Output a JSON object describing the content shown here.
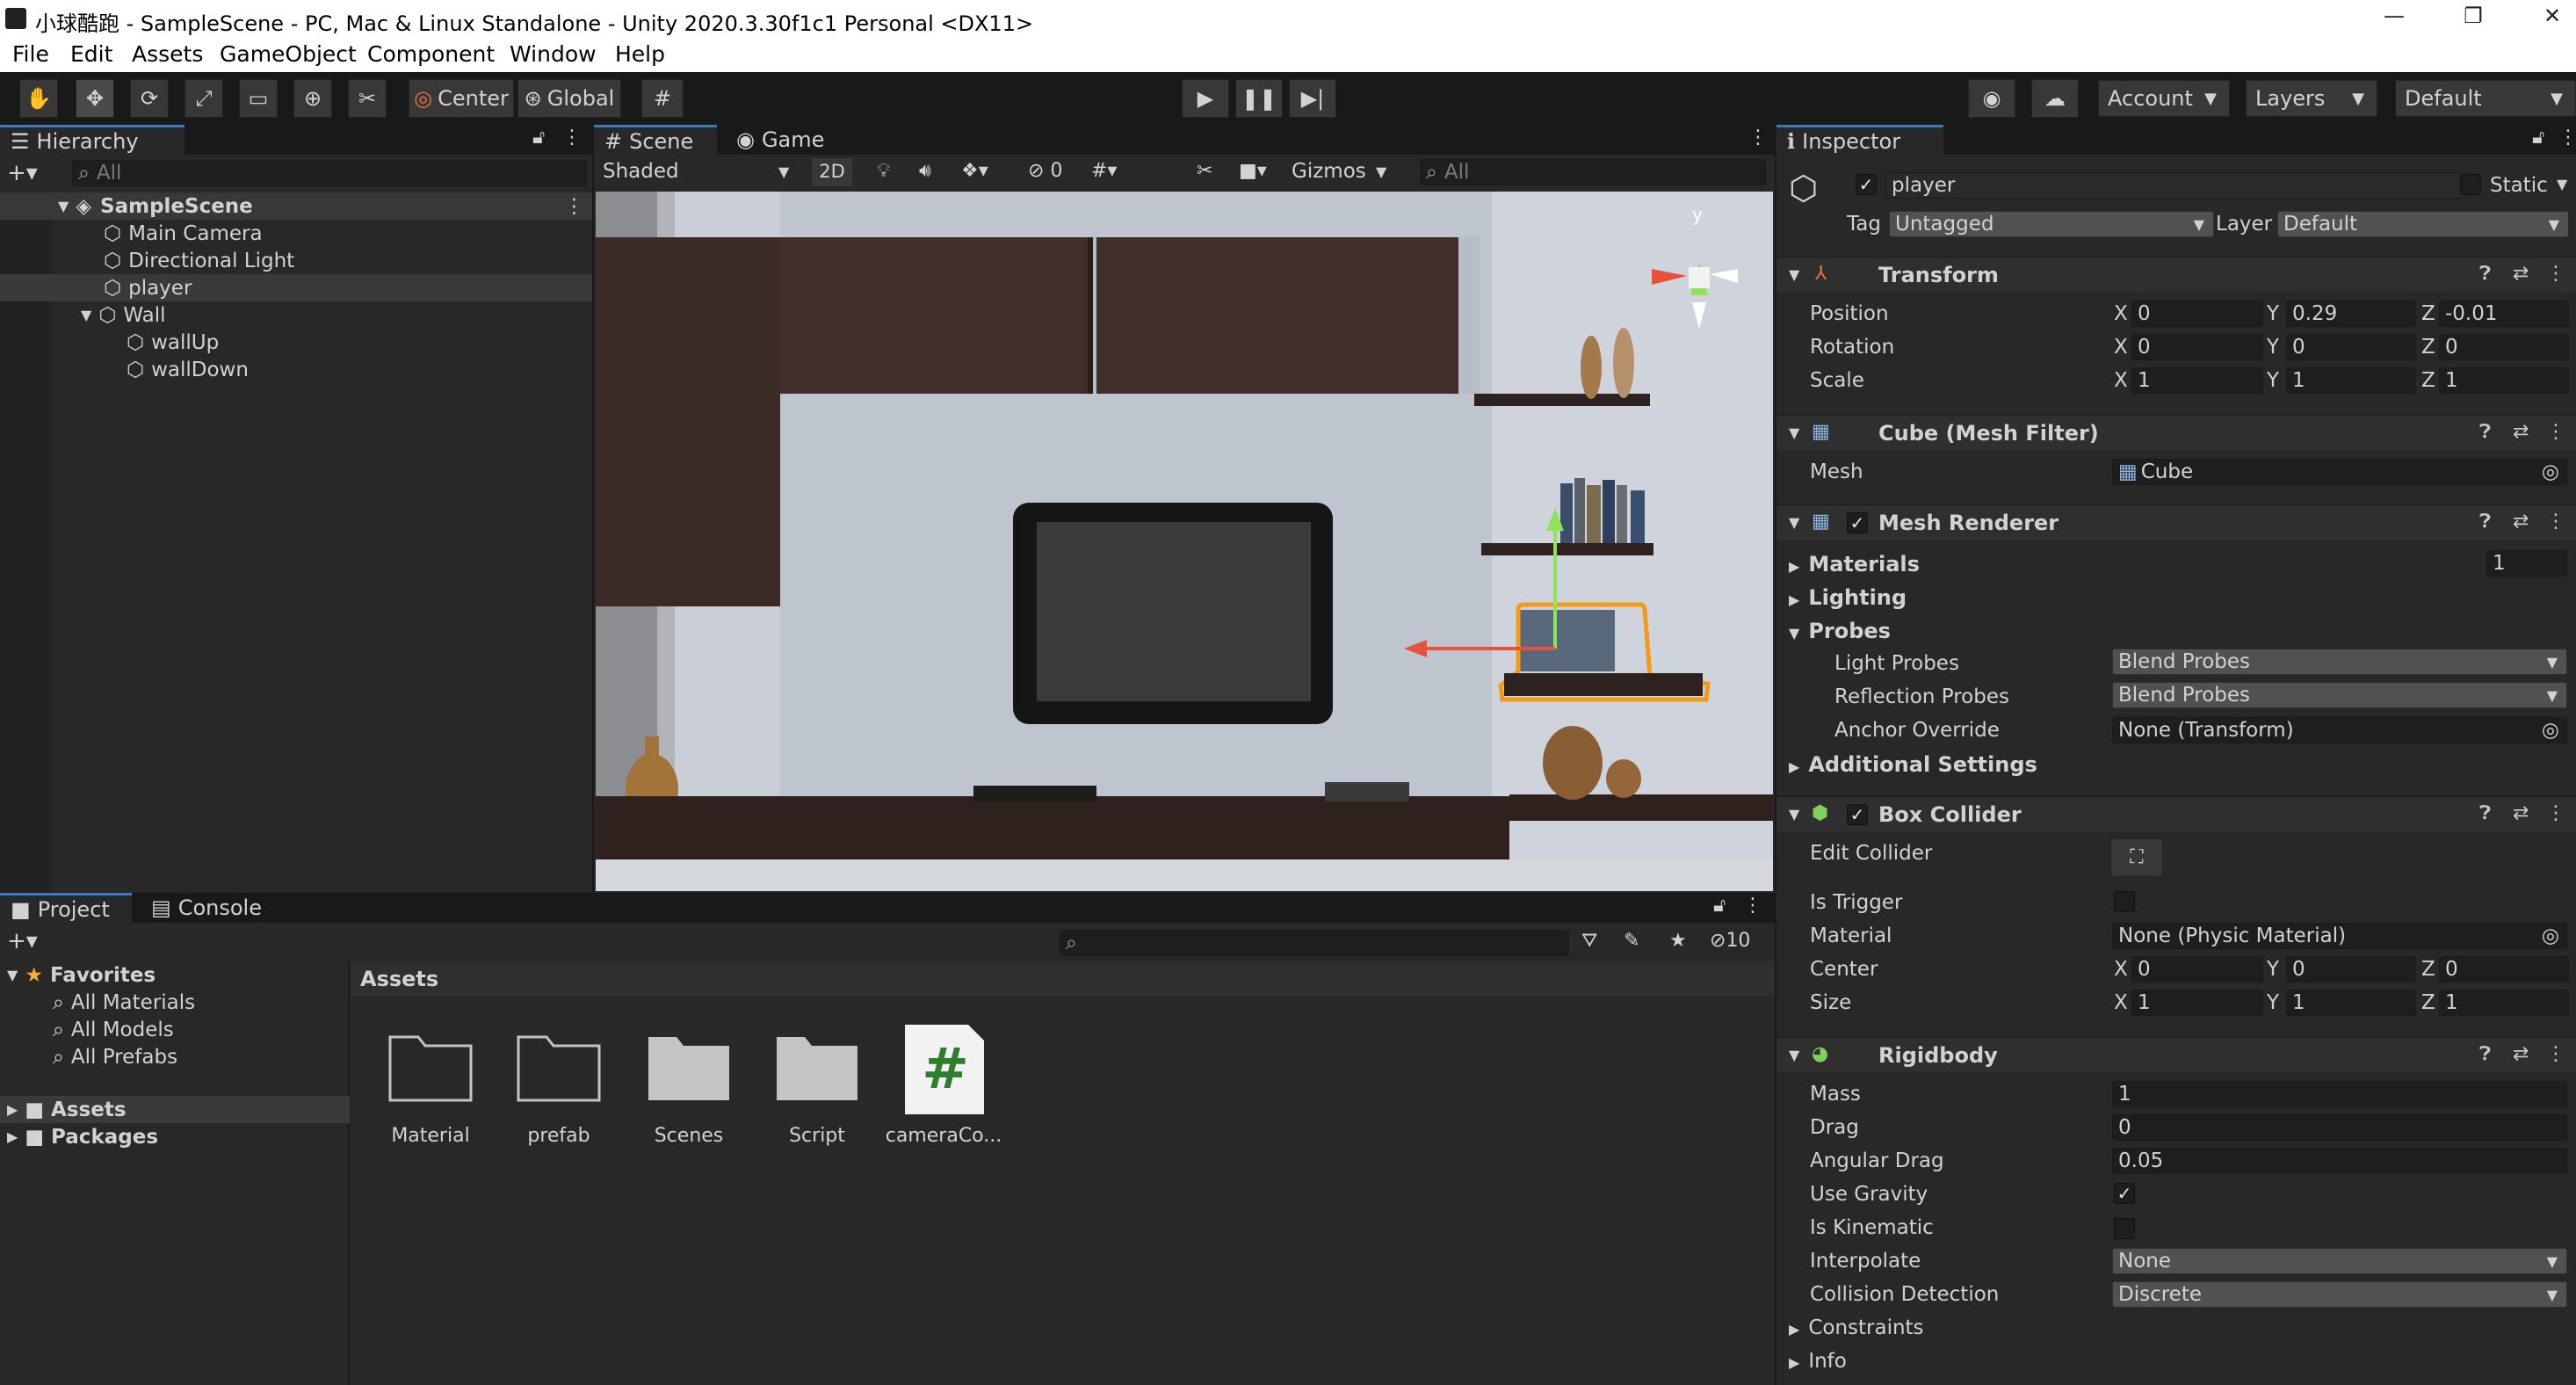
{
  "window": {
    "title": "小球酷跑 - SampleScene - PC, Mac & Linux Standalone - Unity 2020.3.30f1c1 Personal <DX11>",
    "minimize": "—",
    "maximize": "❐",
    "close": "✕"
  },
  "menu": [
    "File",
    "Edit",
    "Assets",
    "GameObject",
    "Component",
    "Window",
    "Help"
  ],
  "toolbar": {
    "center": "Center",
    "global": "Global",
    "account": "Account",
    "layers": "Layers",
    "layout": "Default"
  },
  "hierarchy": {
    "tab": "Hierarchy",
    "search_placeholder": "All",
    "scene": "SampleScene",
    "items": [
      "Main Camera",
      "Directional Light",
      "player",
      "Wall",
      "wallUp",
      "wallDown"
    ]
  },
  "scene": {
    "tab_scene": "Scene",
    "tab_game": "Game",
    "shading": "Shaded",
    "mode2d": "2D",
    "hidden_count": "0",
    "gizmos": "Gizmos",
    "search_placeholder": "All",
    "axis_y": "y"
  },
  "project": {
    "tab_project": "Project",
    "tab_console": "Console",
    "hidden_count": "10",
    "favorites": "Favorites",
    "fav_items": [
      "All Materials",
      "All Models",
      "All Prefabs"
    ],
    "roots": [
      "Assets",
      "Packages"
    ],
    "breadcrumb": "Assets",
    "assets": [
      "Material",
      "prefab",
      "Scenes",
      "Script",
      "cameraCo..."
    ]
  },
  "inspector": {
    "tab": "Inspector",
    "object_name": "player",
    "static": "Static",
    "tag_label": "Tag",
    "tag": "Untagged",
    "layer_label": "Layer",
    "layer": "Default",
    "transform": {
      "title": "Transform",
      "position_label": "Position",
      "rotation_label": "Rotation",
      "scale_label": "Scale",
      "position": [
        "0",
        "0.29",
        "-0.01"
      ],
      "rotation": [
        "0",
        "0",
        "0"
      ],
      "scale": [
        "1",
        "1",
        "1"
      ]
    },
    "axes": [
      "X",
      "Y",
      "Z"
    ],
    "mesh_filter": {
      "title": "Cube (Mesh Filter)",
      "mesh_label": "Mesh",
      "mesh": "Cube"
    },
    "mesh_renderer": {
      "title": "Mesh Renderer",
      "materials": "Materials",
      "materials_count": "1",
      "lighting": "Lighting",
      "probes": "Probes",
      "light_probes_label": "Light Probes",
      "light_probes": "Blend Probes",
      "reflection_probes_label": "Reflection Probes",
      "reflection_probes": "Blend Probes",
      "anchor_label": "Anchor Override",
      "anchor": "None (Transform)",
      "additional": "Additional Settings"
    },
    "box_collider": {
      "title": "Box Collider",
      "edit_label": "Edit Collider",
      "trigger_label": "Is Trigger",
      "material_label": "Material",
      "material": "None (Physic Material)",
      "center_label": "Center",
      "center": [
        "0",
        "0",
        "0"
      ],
      "size_label": "Size",
      "size": [
        "1",
        "1",
        "1"
      ]
    },
    "rigidbody": {
      "title": "Rigidbody",
      "mass_label": "Mass",
      "mass": "1",
      "drag_label": "Drag",
      "drag": "0",
      "angular_label": "Angular Drag",
      "angular": "0.05",
      "gravity_label": "Use Gravity",
      "kinematic_label": "Is Kinematic",
      "interpolate_label": "Interpolate",
      "interpolate": "None",
      "collision_label": "Collision Detection",
      "collision": "Discrete",
      "constraints": "Constraints",
      "info": "Info"
    }
  }
}
